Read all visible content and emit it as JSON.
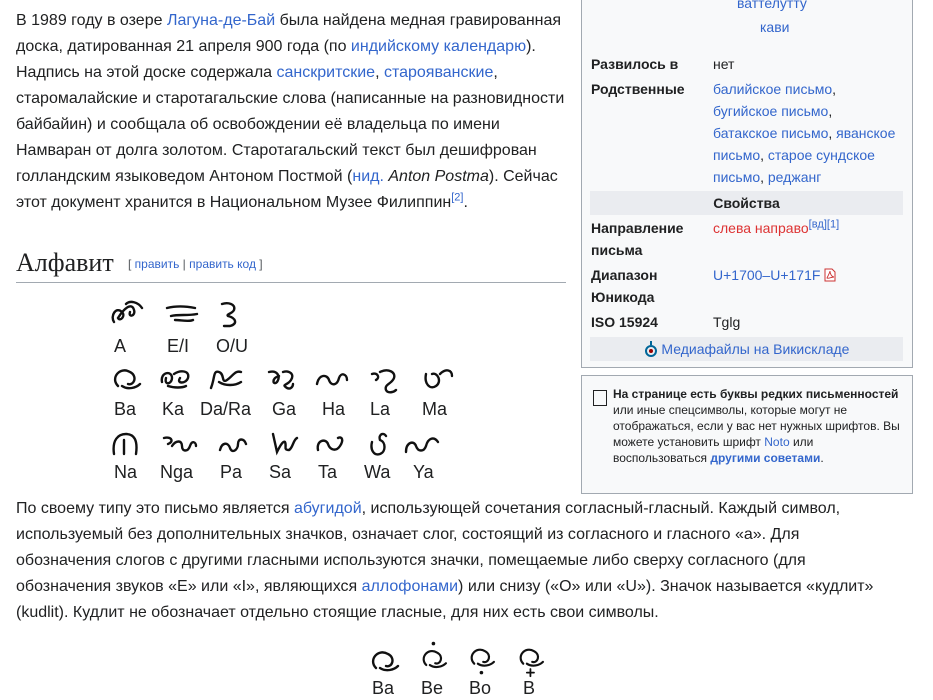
{
  "para1": {
    "t1": "В 1989 году в озере ",
    "l1": "Лагуна-де-Бай",
    "t2": " была найдена медная гравированная доска, датированная 21 апреля 900 года (по ",
    "l2": "индийскому календарю",
    "t3": "). Надпись на этой доске содержала ",
    "l3": "санскритские",
    "t4": ", ",
    "l4": "старояванские",
    "t5": ", старомалайские и старотагальские слова (написанные на разновидности байбайин) и сообщала об освобождении её владельца по имени Намваран от долга золотом. Старотагальский текст был дешифрован голландским языковедом Антоном Постмой (",
    "l5": "нид.",
    "t6": " ",
    "i1": "Anton Postma",
    "t7": "). Сейчас этот документ хранится в Национальном Музее Филиппин",
    "ref": "[2]",
    "t8": "."
  },
  "heading": {
    "title": "Алфавит",
    "lb": "[ ",
    "edit": "править",
    "sep": " | ",
    "edit_code": "править код",
    "rb": " ]"
  },
  "alphabet": {
    "row1": [
      "A",
      "E/I",
      "O/U"
    ],
    "row2": [
      "Ba",
      "Ka",
      "Da/Ra",
      "Ga",
      "Ha",
      "La",
      "Ma"
    ],
    "row3": [
      "Na",
      "Nga",
      "Pa",
      "Sa",
      "Ta",
      "Wa",
      "Ya"
    ]
  },
  "para2": {
    "t1": "По своему типу это письмо является ",
    "l1": "абугидой",
    "t2": ", использующей сочетания согласный-гласный. Каждый символ, используемый без дополнительных значков, означает слог, состоящий из согласного и гласного «а». Для обозначения слогов с другими гласными используются значки, помещаемые либо сверху согласного (для обозначения звуков «E» или «I», являющихся ",
    "l2": "аллофонами",
    "t3": ") или снизу («O» или «U»). Значок называется «кудлит» (kudlit). Кудлит не обозначает отдельно стоящие гласные, для них есть свои символы."
  },
  "bottom_labels": [
    "Ba",
    "Be",
    "Bo",
    "B"
  ],
  "infobox": {
    "top1": "ваттелутту",
    "top2": "кави",
    "k_evolved": "Развилось в",
    "v_evolved": "нет",
    "k_related": "Родственные",
    "related": [
      "балийское письмо",
      "бугийское письмо",
      "батакское письмо",
      "яванское письмо",
      "старое сундское письмо",
      "реджанг"
    ],
    "band_props": "Свойства",
    "k_dir1": "Направление",
    "k_dir2": "письма",
    "v_dir": "слева направо",
    "v_dir_ref": "[вд][1]",
    "k_range1": "Диапазон",
    "k_range2": "Юникода",
    "v_range": "U+1700–U+171F",
    "k_iso": "ISO 15924",
    "v_iso": "Tglg",
    "commons": "Медиафайлы на Викискладе"
  },
  "notice": {
    "b1": "На странице есть буквы редких письменностей",
    "t1": " или иные спецсимволы, которые могут не отображаться, если у вас нет нужных шрифтов. Вы можете установить шрифт ",
    "l1": "Noto",
    "t2": " или воспользоваться ",
    "l2": "другими советами",
    "t3": "."
  }
}
